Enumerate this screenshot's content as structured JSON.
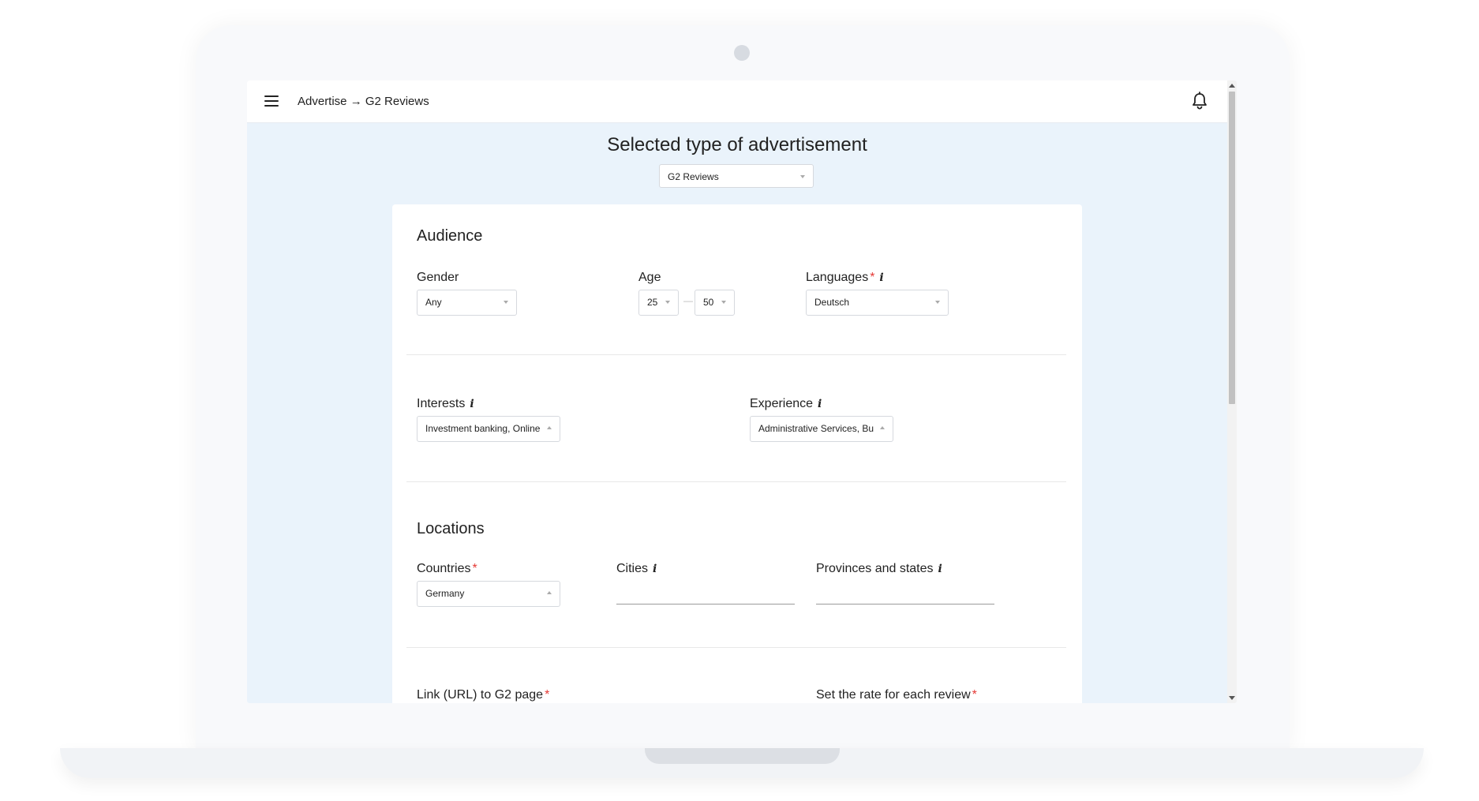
{
  "header": {
    "breadcrumb": "Advertise → G2 Reviews"
  },
  "page": {
    "title": "Selected type of advertisement",
    "ad_type": "G2 Reviews"
  },
  "audience": {
    "title": "Audience",
    "gender": {
      "label": "Gender",
      "value": "Any"
    },
    "age": {
      "label": "Age",
      "min": "25",
      "max": "50",
      "separator": "—"
    },
    "languages": {
      "label": "Languages",
      "required": "*",
      "value": "Deutsch"
    },
    "interests": {
      "label": "Interests",
      "value": "Investment banking, Online"
    },
    "experience": {
      "label": "Experience",
      "value": "Administrative Services, Bu"
    }
  },
  "locations": {
    "title": "Locations",
    "countries": {
      "label": "Countries",
      "required": "*",
      "value": "Germany"
    },
    "cities": {
      "label": "Cities",
      "value": ""
    },
    "provinces": {
      "label": "Provinces and states",
      "value": ""
    }
  },
  "links": {
    "g2_link": {
      "label": "Link (URL) to G2 page",
      "required": "*"
    },
    "rate": {
      "label": "Set the rate for each review",
      "required": "*"
    }
  },
  "icons": {
    "menu": "menu-icon",
    "notifications": "bell-icon",
    "info": "info-icon"
  }
}
